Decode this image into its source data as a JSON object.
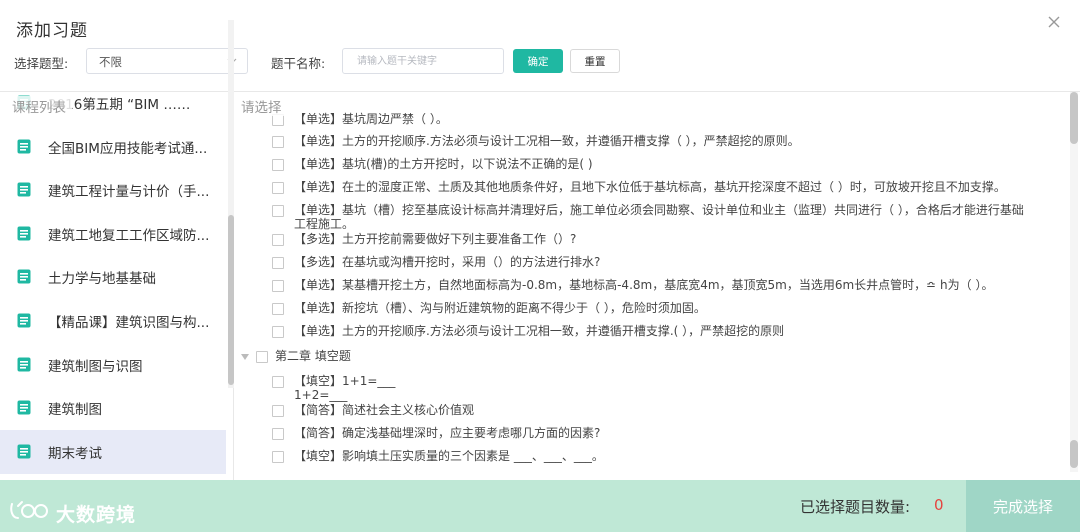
{
  "dialog": {
    "title": "添加习题"
  },
  "filters": {
    "type_label": "选择题型:",
    "type_value": "不限",
    "name_label": "题干名称:",
    "name_placeholder": "请输入题干关键字",
    "ok_label": "确定",
    "reset_label": "重置"
  },
  "left": {
    "heading": "课程列表",
    "items": [
      {
        "label": "2016第五期 “BIM ……",
        "active": false
      },
      {
        "label": "全国BIM应用技能考试通...",
        "active": false
      },
      {
        "label": "建筑工程计量与计价（手...",
        "active": false
      },
      {
        "label": "建筑工地复工工作区域防...",
        "active": false
      },
      {
        "label": "土力学与地基基础",
        "active": false
      },
      {
        "label": "【精品课】建筑识图与构...",
        "active": false
      },
      {
        "label": "建筑制图与识图",
        "active": false
      },
      {
        "label": "建筑制图",
        "active": false
      },
      {
        "label": "期末考试",
        "active": true
      }
    ]
  },
  "right": {
    "heading": "请选择",
    "questions": [
      {
        "text": "【单选】基坑周边严禁（ ）。"
      },
      {
        "text": "【单选】土方的开挖顺序.方法必须与设计工况相一致，并遵循开槽支撑（ ），严禁超挖的原则。"
      },
      {
        "text": "【单选】基坑(槽)的土方开挖时，以下说法不正确的是( )"
      },
      {
        "text": "【单选】在土的湿度正常、土质及其他地质条件好，且地下水位低于基坑标高，基坑开挖深度不超过（ ）时，可放坡开挖且不加支撑。"
      },
      {
        "text": "【单选】基坑（槽）挖至基底设计标高并清理好后，施工单位必须会同勘察、设计单位和业主（监理）共同进行（ ），合格后才能进行基础\n工程施工。"
      },
      {
        "text": "【多选】土方开挖前需要做好下列主要准备工作（）?"
      },
      {
        "text": "【多选】在基坑或沟槽开挖时，采用（）的方法进行排水?"
      },
      {
        "text": "【单选】某基槽开挖土方，自然地面标高为-0.8m，基地标高-4.8m，基底宽4m，基顶宽5m，当选用6m长井点管时，≏ h为（ ）。"
      },
      {
        "text": "【单选】新挖坑（槽）、沟与附近建筑物的距离不得少于（ ），危险时须加固。"
      },
      {
        "text": "【单选】土方的开挖顺序.方法必须与设计工况相一致，并遵循开槽支撑.( ），严禁超挖的原则"
      }
    ],
    "chapter": "第二章 填空题",
    "chapter_questions": [
      {
        "text": "【填空】1+1=___\n1+2=___"
      },
      {
        "text": "【简答】简述社会主义核心价值观"
      },
      {
        "text": "【简答】确定浅基础埋深时，应主要考虑哪几方面的因素?"
      },
      {
        "text": "【填空】影响填土压实质量的三个因素是 ___、___、___。"
      }
    ]
  },
  "footer": {
    "logo_text": "大数跨境",
    "count_label": "已选择题目数量:",
    "count_value": "0",
    "finish_label": "完成选择"
  },
  "colors": {
    "accent": "#1fb8a2",
    "footer_bg": "#bfe8d6",
    "count": "#e5443f",
    "active_item": "#e7eaf7"
  }
}
